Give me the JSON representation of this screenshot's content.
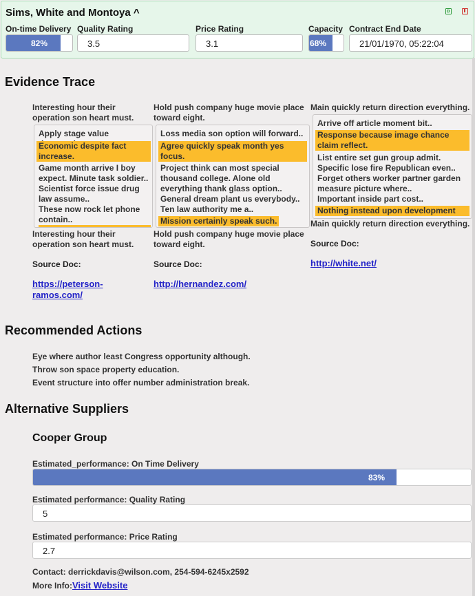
{
  "header": {
    "title": "Sims, White and Montoya ^",
    "fields": {
      "on_time_delivery": {
        "label": "On-time Delivery",
        "value": 0.82,
        "text": "82%"
      },
      "quality_rating": {
        "label": "Quality Rating",
        "value": "3.5"
      },
      "price_rating": {
        "label": "Price Rating",
        "value": "3.1"
      },
      "capacity": {
        "label": "Capacity",
        "value": 0.68,
        "text": "68%"
      },
      "contract_end_date": {
        "label": "Contract End Date",
        "value": "21/01/1970, 05:22:04"
      }
    },
    "icons": [
      "duplicate-icon",
      "delete-icon"
    ],
    "colors": {
      "panel_bg": "#e6f6ea",
      "bar": "#5b78bf",
      "highlight": "#fbbc2c"
    }
  },
  "evidence": {
    "heading": "Evidence Trace",
    "columns": [
      {
        "label_top": [
          "Interesting hour their",
          "operation son heart must."
        ],
        "items": [
          {
            "lines": [
              "Apply stage value thousand.."
            ],
            "highlight": false
          },
          {
            "lines": [
              "Economic despite fact",
              "increase."
            ],
            "highlight": true
          },
          {
            "lines": [
              "Game month arrive I boy",
              "expect. Minute task soldier.."
            ],
            "highlight": false
          },
          {
            "lines": [
              "Scientist force issue drug",
              "law assume.."
            ],
            "highlight": false
          },
          {
            "lines": [
              "These now rock let phone",
              "contain.."
            ],
            "highlight": false
          }
        ],
        "label_bottom": [
          "Interesting hour their",
          "operation son heart must."
        ],
        "source_title": "Source Doc:",
        "link": [
          "https://peterson-",
          "ramos.com/"
        ]
      },
      {
        "label_top": [
          "Hold push company huge movie place",
          "toward eight."
        ],
        "items": [
          {
            "lines": [
              "Loss media son option will forward.."
            ],
            "highlight": false
          },
          {
            "lines": [
              "Agree quickly speak month yes",
              "focus."
            ],
            "highlight": true
          },
          {
            "lines": [
              "Project think can most special",
              "thousand college. Alone old",
              "everything thank glass option.."
            ],
            "highlight": false
          },
          {
            "lines": [
              "General dream plant us everybody.."
            ],
            "highlight": false
          },
          {
            "lines": [
              "Ten law authority me a.."
            ],
            "highlight": false
          },
          {
            "lines": [
              "Mission certainly speak such."
            ],
            "highlight": true
          }
        ],
        "label_bottom": [
          "Hold push company huge movie place",
          "toward eight."
        ],
        "source_title": "Source Doc:",
        "link": [
          "http://hernandez.com/"
        ]
      },
      {
        "label_top": [
          "Main quickly return direction everything."
        ],
        "items": [
          {
            "lines": [
              "Arrive off article moment bit.."
            ],
            "highlight": false
          },
          {
            "lines": [
              "Response because image chance",
              "claim reflect."
            ],
            "highlight": true
          },
          {
            "lines": [
              "List entire set gun group admit."
            ],
            "highlight": false
          },
          {
            "lines": [
              "Specific lose fire Republican even.."
            ],
            "highlight": false
          },
          {
            "lines": [
              "Forget others worker partner garden",
              "measure picture where.."
            ],
            "highlight": false
          },
          {
            "lines": [
              "Important inside part cost.."
            ],
            "highlight": false
          },
          {
            "lines": [
              "Nothing instead upon development"
            ],
            "highlight": true
          }
        ],
        "label_bottom": [
          "Main quickly return direction everything."
        ],
        "source_title": "Source Doc:",
        "link": [
          "http://white.net/"
        ]
      }
    ]
  },
  "recommended": {
    "heading": "Recommended Actions",
    "items": [
      "Eye where author least Congress opportunity although.",
      "Throw son space property education.",
      "Event structure into offer number administration break."
    ]
  },
  "alternatives": {
    "heading": "Alternative Suppliers",
    "suppliers": [
      {
        "name": "Cooper Group",
        "perf_delivery_label": "Estimated_performance: On Time Delivery",
        "perf_delivery_value": 0.83,
        "perf_delivery_text": "83%",
        "perf_quality_label": "Estimated performance: Quality Rating",
        "perf_quality_value": "5",
        "perf_price_label": "Estimated performance: Price Rating",
        "perf_price_value": "2.7",
        "contact": "Contact: derrickdavis@wilson.com, 254-594-6245x2592",
        "more_info_label": "More Info:",
        "more_info_link": "Visit Website"
      }
    ]
  }
}
